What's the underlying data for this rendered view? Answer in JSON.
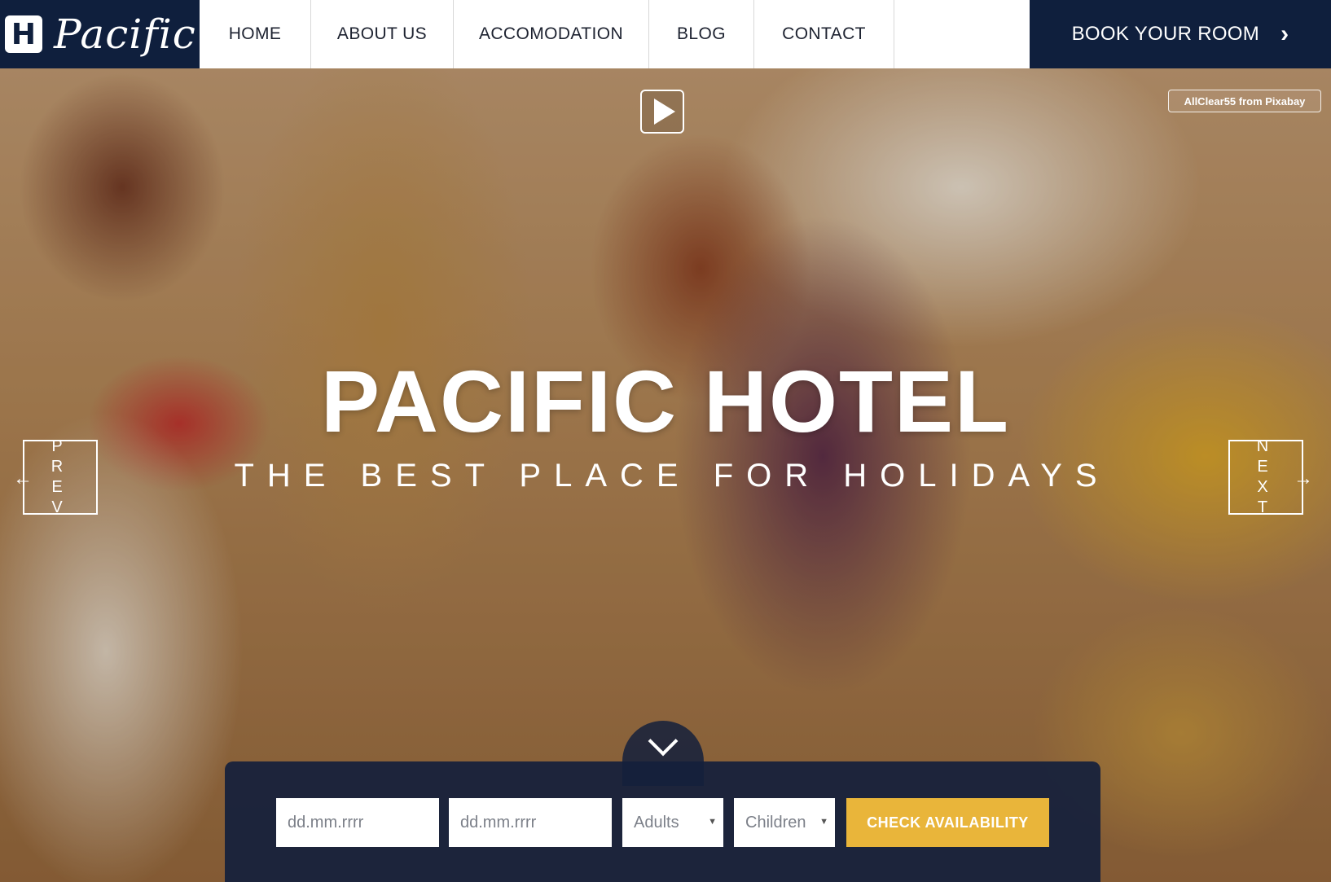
{
  "brand": {
    "logo_letter": "H",
    "name": "Pacific"
  },
  "nav": {
    "items": [
      {
        "label": "HOME"
      },
      {
        "label": "ABOUT US"
      },
      {
        "label": "ACCOMODATION"
      },
      {
        "label": "BLOG"
      },
      {
        "label": "CONTACT"
      }
    ],
    "book_label": "BOOK YOUR ROOM"
  },
  "hero": {
    "title": "PACIFIC HOTEL",
    "subtitle": "THE BEST PLACE FOR HOLIDAYS",
    "credit": "AllClear55 from Pixabay",
    "prev_label": "PREV",
    "next_label": "NEXT"
  },
  "booking": {
    "arrival_placeholder": "dd.mm.rrrr",
    "departure_placeholder": "dd.mm.rrrr",
    "adults_value": "Adults",
    "children_value": "Children",
    "check_label": "CHECK AVAILABILITY"
  },
  "colors": {
    "navy": "#0f1f3d",
    "accent": "#e9b53a",
    "white": "#ffffff"
  },
  "icons": [
    "play-icon",
    "chevron-right-icon",
    "arrow-left-icon",
    "arrow-right-icon",
    "chevron-down-icon"
  ]
}
